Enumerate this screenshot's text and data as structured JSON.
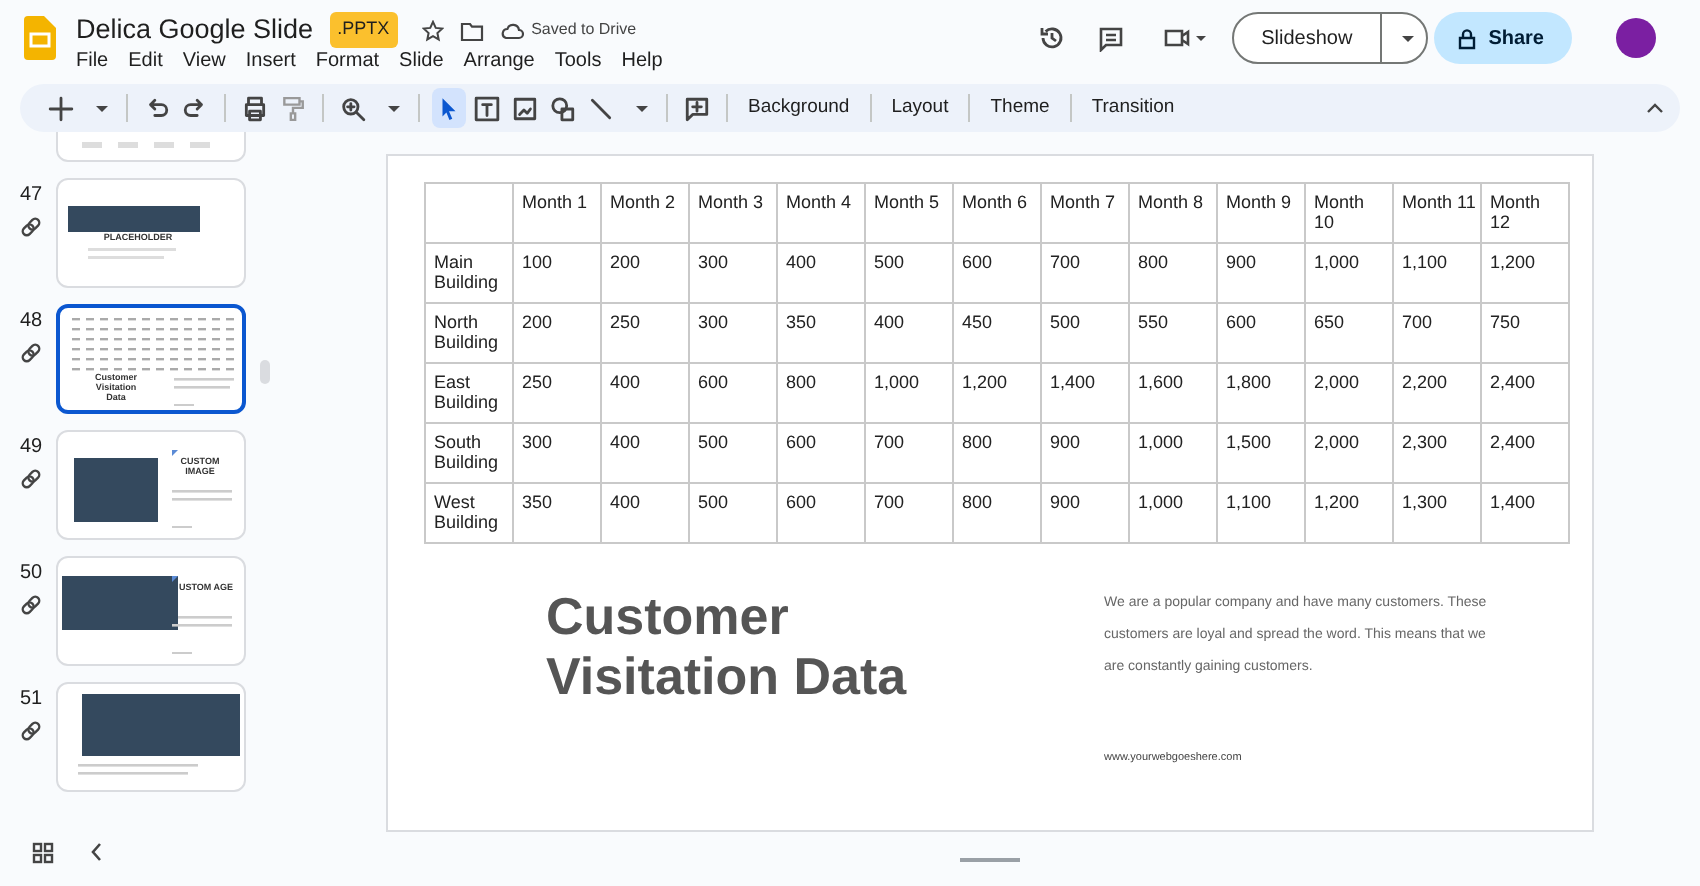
{
  "document": {
    "title": "Delica Google Slide",
    "badge": ".PPTX",
    "save_status": "Saved to Drive"
  },
  "menu": [
    "File",
    "Edit",
    "View",
    "Insert",
    "Format",
    "Slide",
    "Arrange",
    "Tools",
    "Help"
  ],
  "header_actions": {
    "slideshow": "Slideshow",
    "share": "Share"
  },
  "toolbar": {
    "tools": [
      {
        "kind": "add",
        "selected": false
      },
      {
        "kind": "caret",
        "selected": false
      },
      {
        "kind": "undo",
        "selected": false
      },
      {
        "kind": "redo",
        "selected": false
      },
      {
        "kind": "print",
        "selected": false
      },
      {
        "kind": "paint-format",
        "selected": false
      },
      {
        "kind": "zoom",
        "selected": false
      },
      {
        "kind": "caret",
        "selected": false
      },
      {
        "kind": "select",
        "selected": true
      },
      {
        "kind": "text-box",
        "selected": false
      },
      {
        "kind": "image",
        "selected": false
      },
      {
        "kind": "shape",
        "selected": false
      },
      {
        "kind": "line",
        "selected": false
      },
      {
        "kind": "caret",
        "selected": false
      },
      {
        "kind": "comment",
        "selected": false
      }
    ],
    "buttons": [
      "Background",
      "Layout",
      "Theme",
      "Transition"
    ]
  },
  "slides": [
    {
      "kind": "table-strip",
      "selected": false
    },
    {
      "number": "47",
      "kind": "placeholder",
      "selected": false,
      "texts": [
        "PLACEHOLDER"
      ]
    },
    {
      "number": "48",
      "kind": "table",
      "selected": true,
      "texts": [
        "Customer Visitation Data"
      ]
    },
    {
      "number": "49",
      "kind": "custom-image",
      "selected": false,
      "texts": [
        "CUSTOM IMAGE"
      ]
    },
    {
      "number": "50",
      "kind": "custom-image-overlap",
      "selected": false,
      "texts": [
        "USTOM AGE"
      ]
    },
    {
      "number": "51",
      "kind": "wide-image",
      "selected": false
    }
  ],
  "slide": {
    "table": {
      "columns": [
        "",
        "Month 1",
        "Month 2",
        "Month 3",
        "Month 4",
        "Month 5",
        "Month 6",
        "Month 7",
        "Month 8",
        "Month 9",
        "Month 10",
        "Month 11",
        "Month 12"
      ],
      "rows": [
        {
          "label": "Main Building",
          "values": [
            "100",
            "200",
            "300",
            "400",
            "500",
            "600",
            "700",
            "800",
            "900",
            "1,000",
            "1,100",
            "1,200"
          ]
        },
        {
          "label": "North Building",
          "values": [
            "200",
            "250",
            "300",
            "350",
            "400",
            "450",
            "500",
            "550",
            "600",
            "650",
            "700",
            "750"
          ]
        },
        {
          "label": "East Building",
          "values": [
            "250",
            "400",
            "600",
            "800",
            "1,000",
            "1,200",
            "1,400",
            "1,600",
            "1,800",
            "2,000",
            "2,200",
            "2,400"
          ]
        },
        {
          "label": "South Building",
          "values": [
            "300",
            "400",
            "500",
            "600",
            "700",
            "800",
            "900",
            "1,000",
            "1,500",
            "2,000",
            "2,300",
            "2,400"
          ]
        },
        {
          "label": "West Building",
          "values": [
            "350",
            "400",
            "500",
            "600",
            "700",
            "800",
            "900",
            "1,000",
            "1,100",
            "1,200",
            "1,300",
            "1,400"
          ]
        }
      ]
    },
    "title": "Customer Visitation Data",
    "body": "We are a popular company and have many customers. These customers are loyal and spread the word. This means that we are constantly gaining customers.",
    "url": "www.yourwebgoeshere.com"
  }
}
